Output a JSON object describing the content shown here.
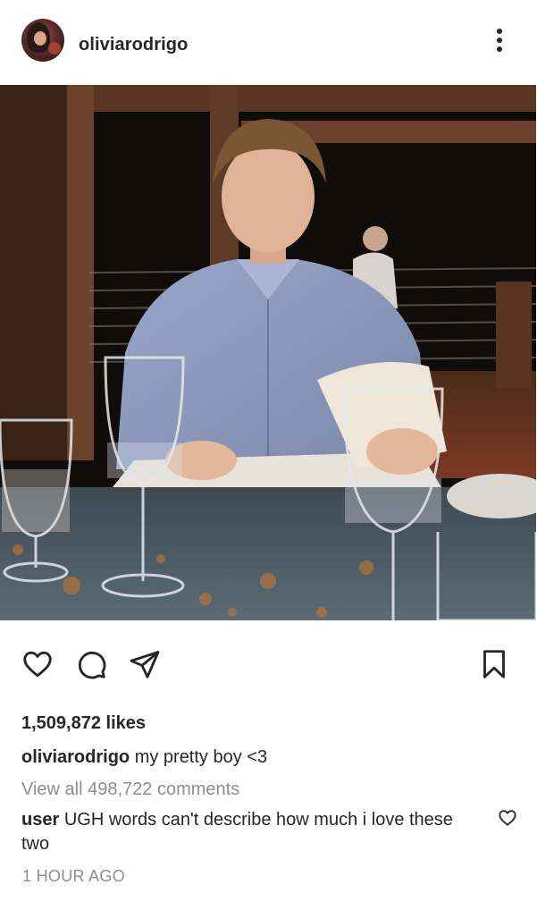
{
  "post": {
    "username": "oliviarodrigo",
    "likes": "1,509,872 likes",
    "caption": {
      "user": "oliviarodrigo",
      "text": "my pretty boy <3"
    },
    "view_all_comments": "View all 498,722 comments",
    "comment": {
      "user": "user",
      "text": "UGH words can't describe how much i love these two"
    },
    "timestamp": "1 HOUR AGO"
  },
  "icons": {
    "more": "more-options-icon",
    "like": "heart-icon",
    "comment": "comment-bubble-icon",
    "share": "paper-plane-icon",
    "save": "bookmark-icon",
    "comment_like": "heart-icon"
  },
  "colors": {
    "text": "#262626",
    "secondary": "#8e8e8e",
    "background": "#ffffff"
  }
}
